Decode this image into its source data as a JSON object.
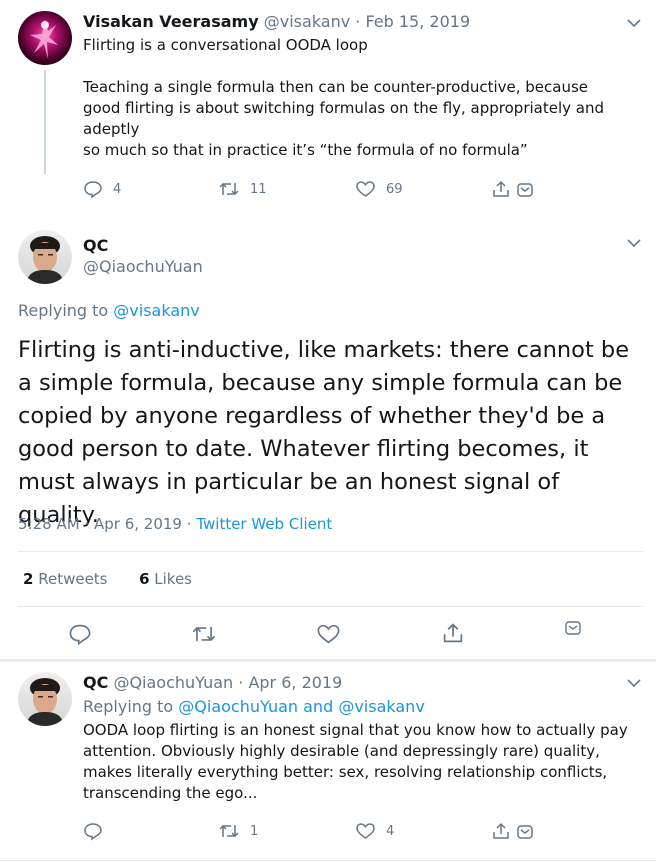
{
  "tweet1": {
    "author_name": "Visakan Veerasamy",
    "author_handle": "@visakanv",
    "separator": "·",
    "date": "Feb 15, 2019",
    "lines": [
      "Flirting is a conversational OODA loop",
      "Teaching a single formula then can be counter-productive, because good flirting is about switching formulas on the fly, appropriately and adeptly",
      "so much so that in practice it’s “the formula of no formula”"
    ],
    "replies": "4",
    "retweets": "11",
    "likes": "69"
  },
  "main_tweet": {
    "author_name": "QC",
    "author_handle": "@QiaochuYuan",
    "replying_prefix": "Replying to",
    "replying_to": "@visakanv",
    "text": "Flirting is anti-inductive, like markets: there cannot be a simple formula, because any simple formula can be copied by anyone regardless of whether they'd be a good person to date. Whatever flirting becomes, it must always in particular be an honest signal of quality.",
    "time": "5:28 AM",
    "separator": "·",
    "date": "Apr 6, 2019",
    "client": "Twitter Web Client",
    "retweet_count": "2",
    "retweet_label": "Retweets",
    "like_count": "6",
    "like_label": "Likes"
  },
  "reply_tweet": {
    "author_name": "QC",
    "author_handle": "@QiaochuYuan",
    "separator": "·",
    "date": "Apr 6, 2019",
    "replying_prefix": "Replying to",
    "replying_to_1": "@QiaochuYuan",
    "and_word": "and",
    "replying_to_2": "@visakanv",
    "text": "OODA loop flirting is an honest signal that you know how to actually pay attention. Obviously highly desirable (and depressingly rare) quality, makes literally everything better: sex, resolving relationship conflicts, transcending the ego...",
    "replies": "",
    "retweets": "1",
    "likes": "4"
  },
  "icons": [
    "chevron-down-icon",
    "reply-icon",
    "retweet-icon",
    "like-icon",
    "share-icon",
    "dm-icon"
  ],
  "colors": {
    "text": "#14171a",
    "muted": "#657786",
    "link": "#1b95e0",
    "divider": "#e6ecf0"
  }
}
